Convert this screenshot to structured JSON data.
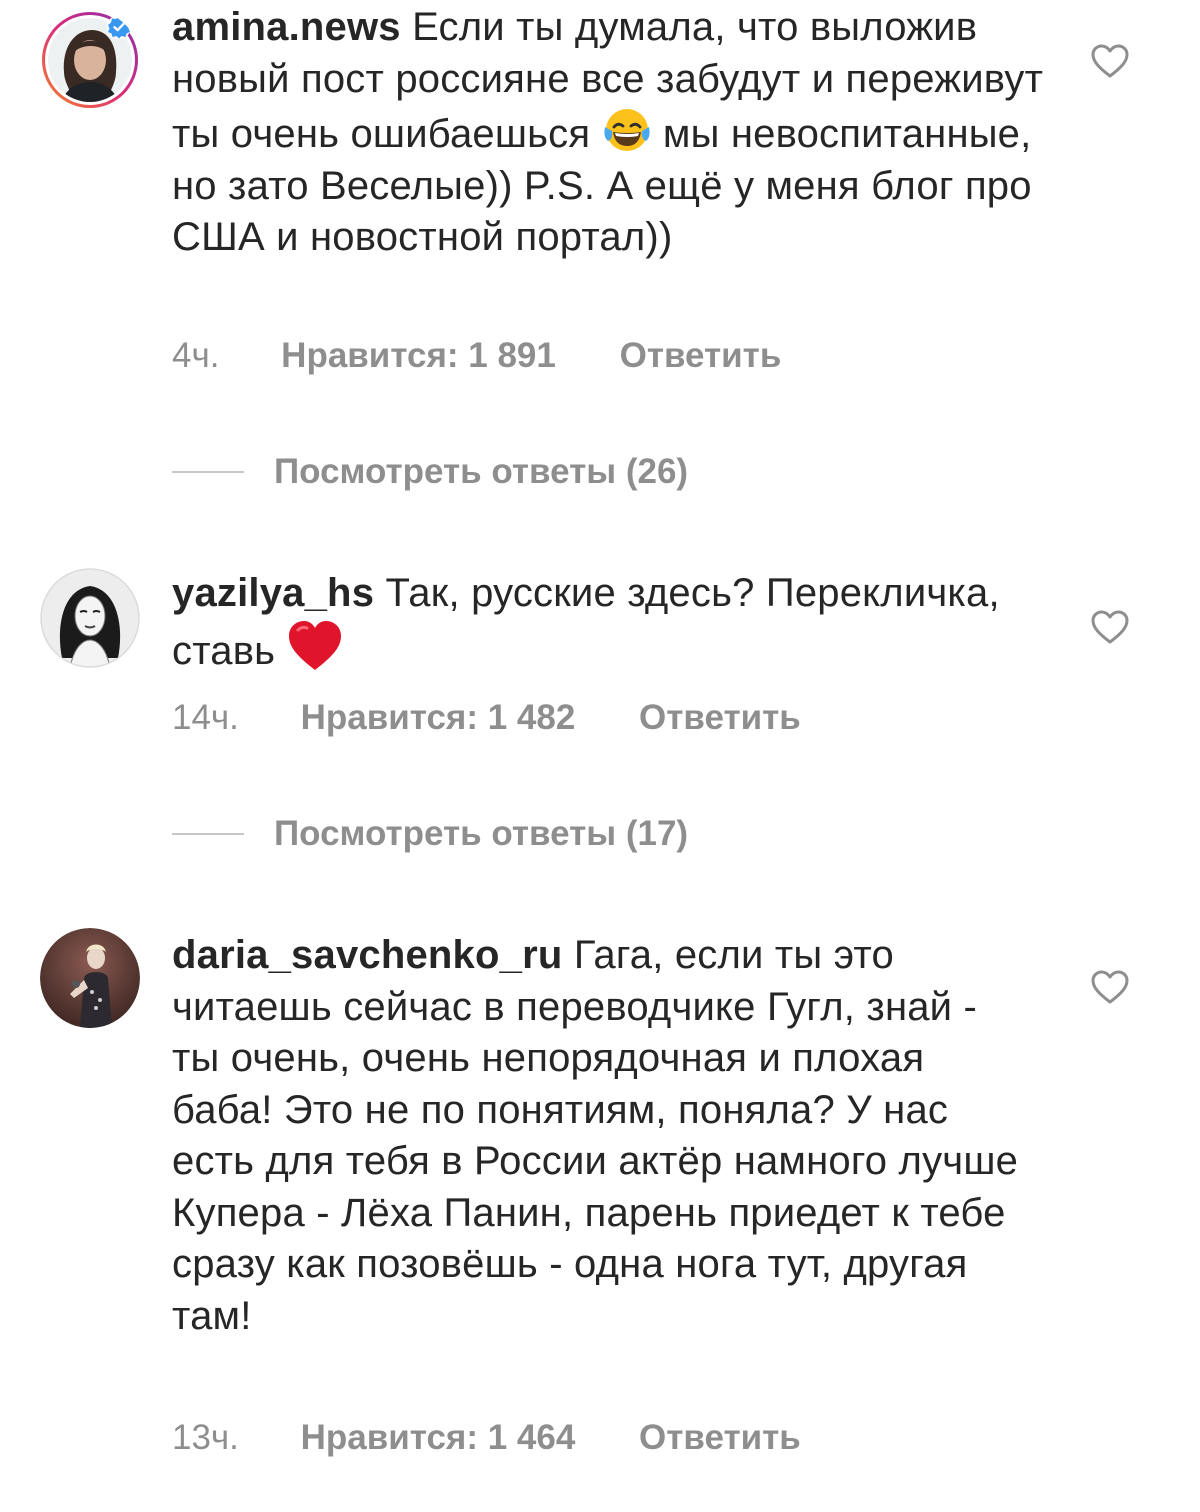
{
  "comments": [
    {
      "username": "amina.news",
      "verified": true,
      "text_before_emoji": "Если ты думала, что выложив новый пост россияне все забудут и переживут ты очень ошибаешься",
      "emoji": "face-with-tears-of-joy",
      "text_after_emoji": "мы невоспитанные, но зато Веселые)) P.S. А ещё у меня блог про США и новостной портал))",
      "time": "4ч.",
      "likes": "Нравится: 1 891",
      "reply_label": "Ответить",
      "view_replies": "Посмотреть ответы (26)"
    },
    {
      "username": "yazilya_hs",
      "verified": false,
      "text_before_emoji": "Так, русские здесь? Перекличка, ставь",
      "emoji": "red-heart",
      "text_after_emoji": "",
      "time": "14ч.",
      "likes": "Нравится: 1 482",
      "reply_label": "Ответить",
      "view_replies": "Посмотреть ответы (17)"
    },
    {
      "username": "daria_savchenko_ru",
      "verified": false,
      "text_before_emoji": "Гага, если ты это читаешь сейчас в переводчике Гугл, знай - ты очень, очень непорядочная и плохая баба! Это не по понятиям, поняла? У нас есть для тебя в России актёр намного лучше Купера - Лёха Панин, парень приедет к тебе сразу как позовёшь - одна нога тут, другая там!",
      "emoji": "",
      "text_after_emoji": "",
      "time": "13ч.",
      "likes": "Нравится: 1 464",
      "reply_label": "Ответить"
    }
  ],
  "colors": {
    "primary_text": "#262626",
    "secondary_text": "#8e8e8e",
    "divider": "#c7c7c7",
    "verified_badge": "#3897f0",
    "story_ring_start": "#f58529",
    "story_ring_end": "#dd2a7b",
    "heart_emoji": "#e0142a"
  },
  "icons": {
    "like": "heart-outline-icon",
    "verified": "verified-badge-icon"
  }
}
